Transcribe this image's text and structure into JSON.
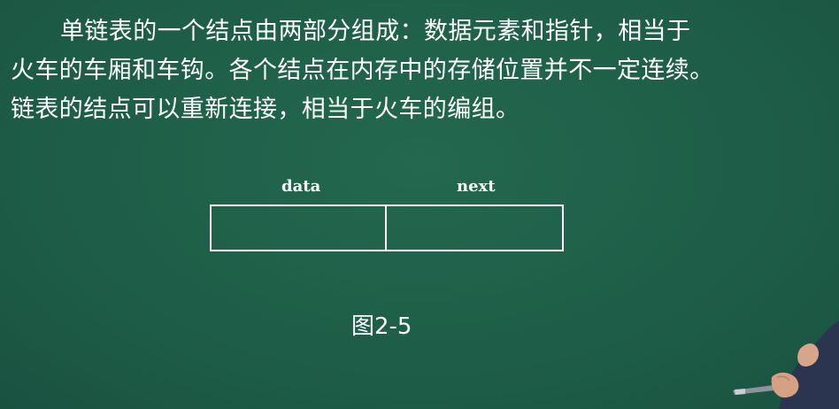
{
  "paragraph": {
    "line1": "单链表的一个结点由两部分组成：数据元素和指针，相当于",
    "line2": "火车的车厢和车钩。各个结点在内存中的存储位置并不一定连续。",
    "line3": "链表的结点可以重新连接，相当于火车的编组。"
  },
  "diagram": {
    "data_label": "data",
    "next_label": "next",
    "caption": "图2-5"
  },
  "colors": {
    "board": "#1e5f4b",
    "text": "#ffffff"
  }
}
